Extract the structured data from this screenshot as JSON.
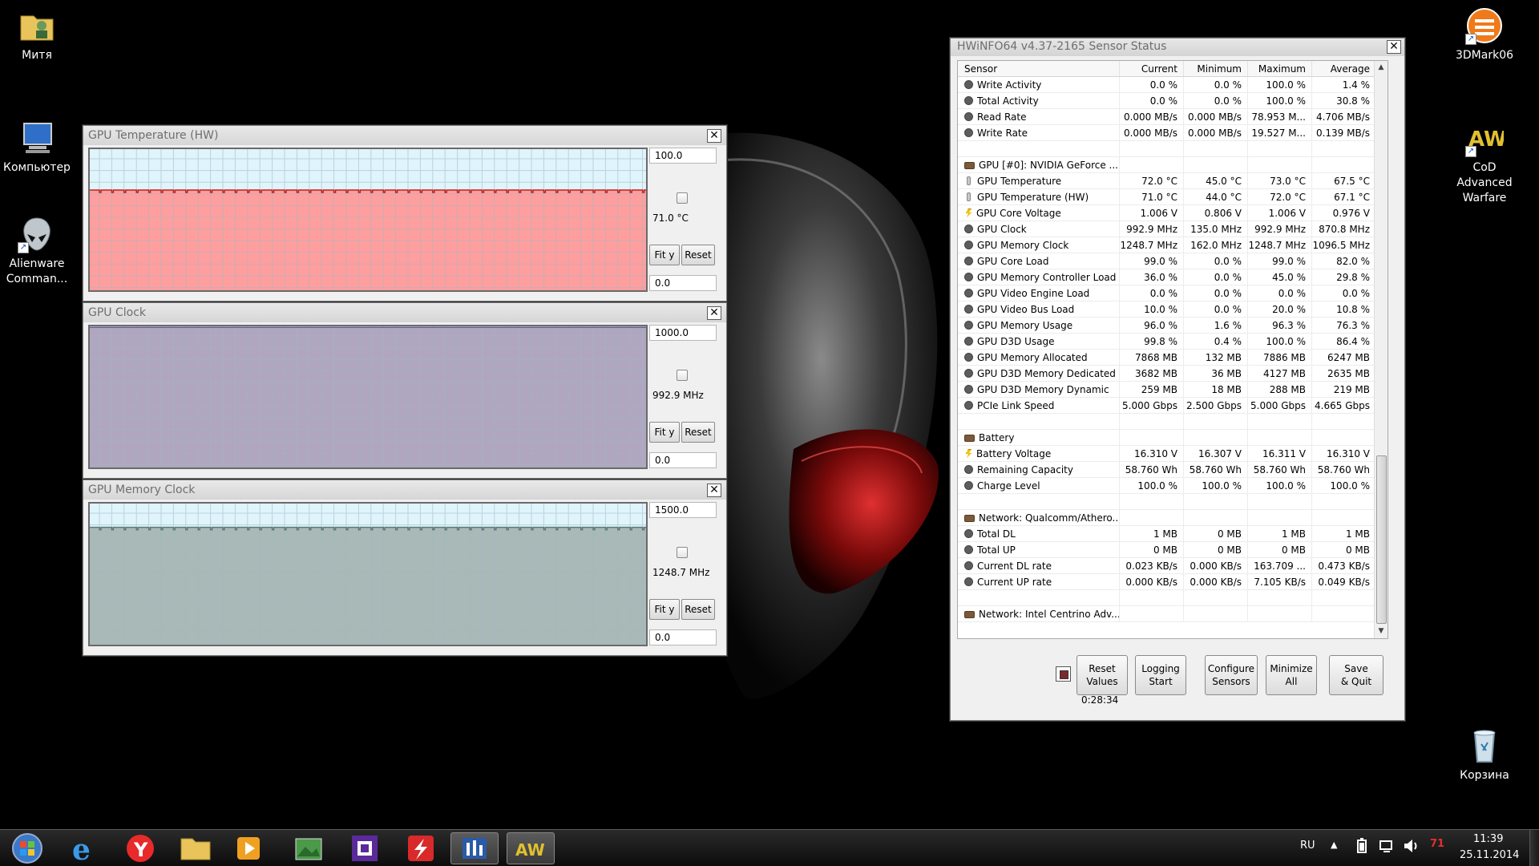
{
  "desktop_icons": [
    {
      "name": "folder-user",
      "label": "Митя"
    },
    {
      "name": "computer",
      "label": "Компьютер"
    },
    {
      "name": "alienware",
      "label": "Alienware Comman..."
    },
    {
      "name": "3dmark",
      "label": "3DMark06"
    },
    {
      "name": "cod",
      "label": "CoD Advanced Warfare"
    },
    {
      "name": "recycle-bin",
      "label": "Корзина"
    }
  ],
  "graphs": [
    {
      "title": "GPU Temperature (HW)",
      "top_value": "100.0",
      "current": "71.0 °C",
      "bottom_value": "0.0",
      "fit_label": "Fit y",
      "reset_label": "Reset",
      "fill_color": "#ff9e9e",
      "bg_color": "#dff4fb",
      "line_color": "#c02020",
      "fill_fraction": 0.71
    },
    {
      "title": "GPU Clock",
      "top_value": "1000.0",
      "current": "992.9 MHz",
      "bottom_value": "0.0",
      "fit_label": "Fit y",
      "reset_label": "Reset",
      "fill_color": "#b0a6c0",
      "bg_color": "#dff4fb",
      "line_color": "#6a5a8a",
      "fill_fraction": 0.993
    },
    {
      "title": "GPU Memory Clock",
      "top_value": "1500.0",
      "current": "1248.7 MHz",
      "bottom_value": "0.0",
      "fit_label": "Fit y",
      "reset_label": "Reset",
      "fill_color": "#a9b9b7",
      "bg_color": "#dff4fb",
      "line_color": "#5a7a76",
      "fill_fraction": 0.832
    }
  ],
  "hwinfo": {
    "title": "HWiNFO64 v4.37-2165 Sensor Status",
    "columns": [
      "Sensor",
      "Current",
      "Minimum",
      "Maximum",
      "Average"
    ],
    "rows": [
      {
        "icon": "dot",
        "label": "Write Activity",
        "cur": "0.0 %",
        "min": "0.0 %",
        "max": "100.0 %",
        "avg": "1.4 %"
      },
      {
        "icon": "dot",
        "label": "Total Activity",
        "cur": "0.0 %",
        "min": "0.0 %",
        "max": "100.0 %",
        "avg": "30.8 %"
      },
      {
        "icon": "dot",
        "label": "Read Rate",
        "cur": "0.000 MB/s",
        "min": "0.000 MB/s",
        "max": "78.953 M...",
        "avg": "4.706 MB/s"
      },
      {
        "icon": "dot",
        "label": "Write Rate",
        "cur": "0.000 MB/s",
        "min": "0.000 MB/s",
        "max": "19.527 M...",
        "avg": "0.139 MB/s"
      },
      {
        "icon": "none",
        "label": "",
        "cur": "",
        "min": "",
        "max": "",
        "avg": ""
      },
      {
        "icon": "grp",
        "label": "GPU [#0]: NVIDIA GeForce ...",
        "cur": "",
        "min": "",
        "max": "",
        "avg": ""
      },
      {
        "icon": "therm",
        "label": "GPU Temperature",
        "cur": "72.0 °C",
        "min": "45.0 °C",
        "max": "73.0 °C",
        "avg": "67.5 °C"
      },
      {
        "icon": "therm",
        "label": "GPU Temperature (HW)",
        "cur": "71.0 °C",
        "min": "44.0 °C",
        "max": "72.0 °C",
        "avg": "67.1 °C"
      },
      {
        "icon": "volt",
        "label": "GPU Core Voltage",
        "cur": "1.006 V",
        "min": "0.806 V",
        "max": "1.006 V",
        "avg": "0.976 V"
      },
      {
        "icon": "dot",
        "label": "GPU Clock",
        "cur": "992.9 MHz",
        "min": "135.0 MHz",
        "max": "992.9 MHz",
        "avg": "870.8 MHz"
      },
      {
        "icon": "dot",
        "label": "GPU Memory Clock",
        "cur": "1248.7 MHz",
        "min": "162.0 MHz",
        "max": "1248.7 MHz",
        "avg": "1096.5 MHz"
      },
      {
        "icon": "dot",
        "label": "GPU Core Load",
        "cur": "99.0 %",
        "min": "0.0 %",
        "max": "99.0 %",
        "avg": "82.0 %"
      },
      {
        "icon": "dot",
        "label": "GPU Memory Controller Load",
        "cur": "36.0 %",
        "min": "0.0 %",
        "max": "45.0 %",
        "avg": "29.8 %"
      },
      {
        "icon": "dot",
        "label": "GPU Video Engine Load",
        "cur": "0.0 %",
        "min": "0.0 %",
        "max": "0.0 %",
        "avg": "0.0 %"
      },
      {
        "icon": "dot",
        "label": "GPU Video Bus Load",
        "cur": "10.0 %",
        "min": "0.0 %",
        "max": "20.0 %",
        "avg": "10.8 %"
      },
      {
        "icon": "dot",
        "label": "GPU Memory Usage",
        "cur": "96.0 %",
        "min": "1.6 %",
        "max": "96.3 %",
        "avg": "76.3 %"
      },
      {
        "icon": "dot",
        "label": "GPU D3D Usage",
        "cur": "99.8 %",
        "min": "0.4 %",
        "max": "100.0 %",
        "avg": "86.4 %"
      },
      {
        "icon": "dot",
        "label": "GPU Memory Allocated",
        "cur": "7868 MB",
        "min": "132 MB",
        "max": "7886 MB",
        "avg": "6247 MB"
      },
      {
        "icon": "dot",
        "label": "GPU D3D Memory Dedicated",
        "cur": "3682 MB",
        "min": "36 MB",
        "max": "4127 MB",
        "avg": "2635 MB"
      },
      {
        "icon": "dot",
        "label": "GPU D3D Memory Dynamic",
        "cur": "259 MB",
        "min": "18 MB",
        "max": "288 MB",
        "avg": "219 MB"
      },
      {
        "icon": "dot",
        "label": "PCIe Link Speed",
        "cur": "5.000 Gbps",
        "min": "2.500 Gbps",
        "max": "5.000 Gbps",
        "avg": "4.665 Gbps"
      },
      {
        "icon": "none",
        "label": "",
        "cur": "",
        "min": "",
        "max": "",
        "avg": ""
      },
      {
        "icon": "grp",
        "label": "Battery",
        "cur": "",
        "min": "",
        "max": "",
        "avg": ""
      },
      {
        "icon": "volt",
        "label": "Battery Voltage",
        "cur": "16.310 V",
        "min": "16.307 V",
        "max": "16.311 V",
        "avg": "16.310 V"
      },
      {
        "icon": "dot",
        "label": "Remaining Capacity",
        "cur": "58.760 Wh",
        "min": "58.760 Wh",
        "max": "58.760 Wh",
        "avg": "58.760 Wh"
      },
      {
        "icon": "dot",
        "label": "Charge Level",
        "cur": "100.0 %",
        "min": "100.0 %",
        "max": "100.0 %",
        "avg": "100.0 %"
      },
      {
        "icon": "none",
        "label": "",
        "cur": "",
        "min": "",
        "max": "",
        "avg": ""
      },
      {
        "icon": "grp",
        "label": "Network: Qualcomm/Athero...",
        "cur": "",
        "min": "",
        "max": "",
        "avg": ""
      },
      {
        "icon": "dot",
        "label": "Total DL",
        "cur": "1 MB",
        "min": "0 MB",
        "max": "1 MB",
        "avg": "1 MB"
      },
      {
        "icon": "dot",
        "label": "Total UP",
        "cur": "0 MB",
        "min": "0 MB",
        "max": "0 MB",
        "avg": "0 MB"
      },
      {
        "icon": "dot",
        "label": "Current DL rate",
        "cur": "0.023 KB/s",
        "min": "0.000 KB/s",
        "max": "163.709 ...",
        "avg": "0.473 KB/s"
      },
      {
        "icon": "dot",
        "label": "Current UP rate",
        "cur": "0.000 KB/s",
        "min": "0.000 KB/s",
        "max": "7.105 KB/s",
        "avg": "0.049 KB/s"
      },
      {
        "icon": "none",
        "label": "",
        "cur": "",
        "min": "",
        "max": "",
        "avg": ""
      },
      {
        "icon": "grp",
        "label": "Network: Intel Centrino Adv...",
        "cur": "",
        "min": "",
        "max": "",
        "avg": ""
      }
    ],
    "buttons": [
      {
        "name": "reset-values",
        "line1": "Reset",
        "line2": "Values"
      },
      {
        "name": "logging-start",
        "line1": "Logging",
        "line2": "Start"
      },
      {
        "name": "configure-sensors",
        "line1": "Configure",
        "line2": "Sensors"
      },
      {
        "name": "minimize-all",
        "line1": "Minimize",
        "line2": "All"
      },
      {
        "name": "save-quit",
        "line1": "Save",
        "line2": "& Quit"
      }
    ],
    "timer": "0:28:34"
  },
  "taskbar": {
    "apps": [
      "start",
      "internet-explorer",
      "yandex-browser",
      "file-explorer",
      "media-player",
      "image-viewer",
      "cpu-z",
      "msi-afterburner",
      "hwinfo",
      "alienware-aw"
    ],
    "language": "RU",
    "time": "11:39",
    "date": "25.11.2014"
  }
}
